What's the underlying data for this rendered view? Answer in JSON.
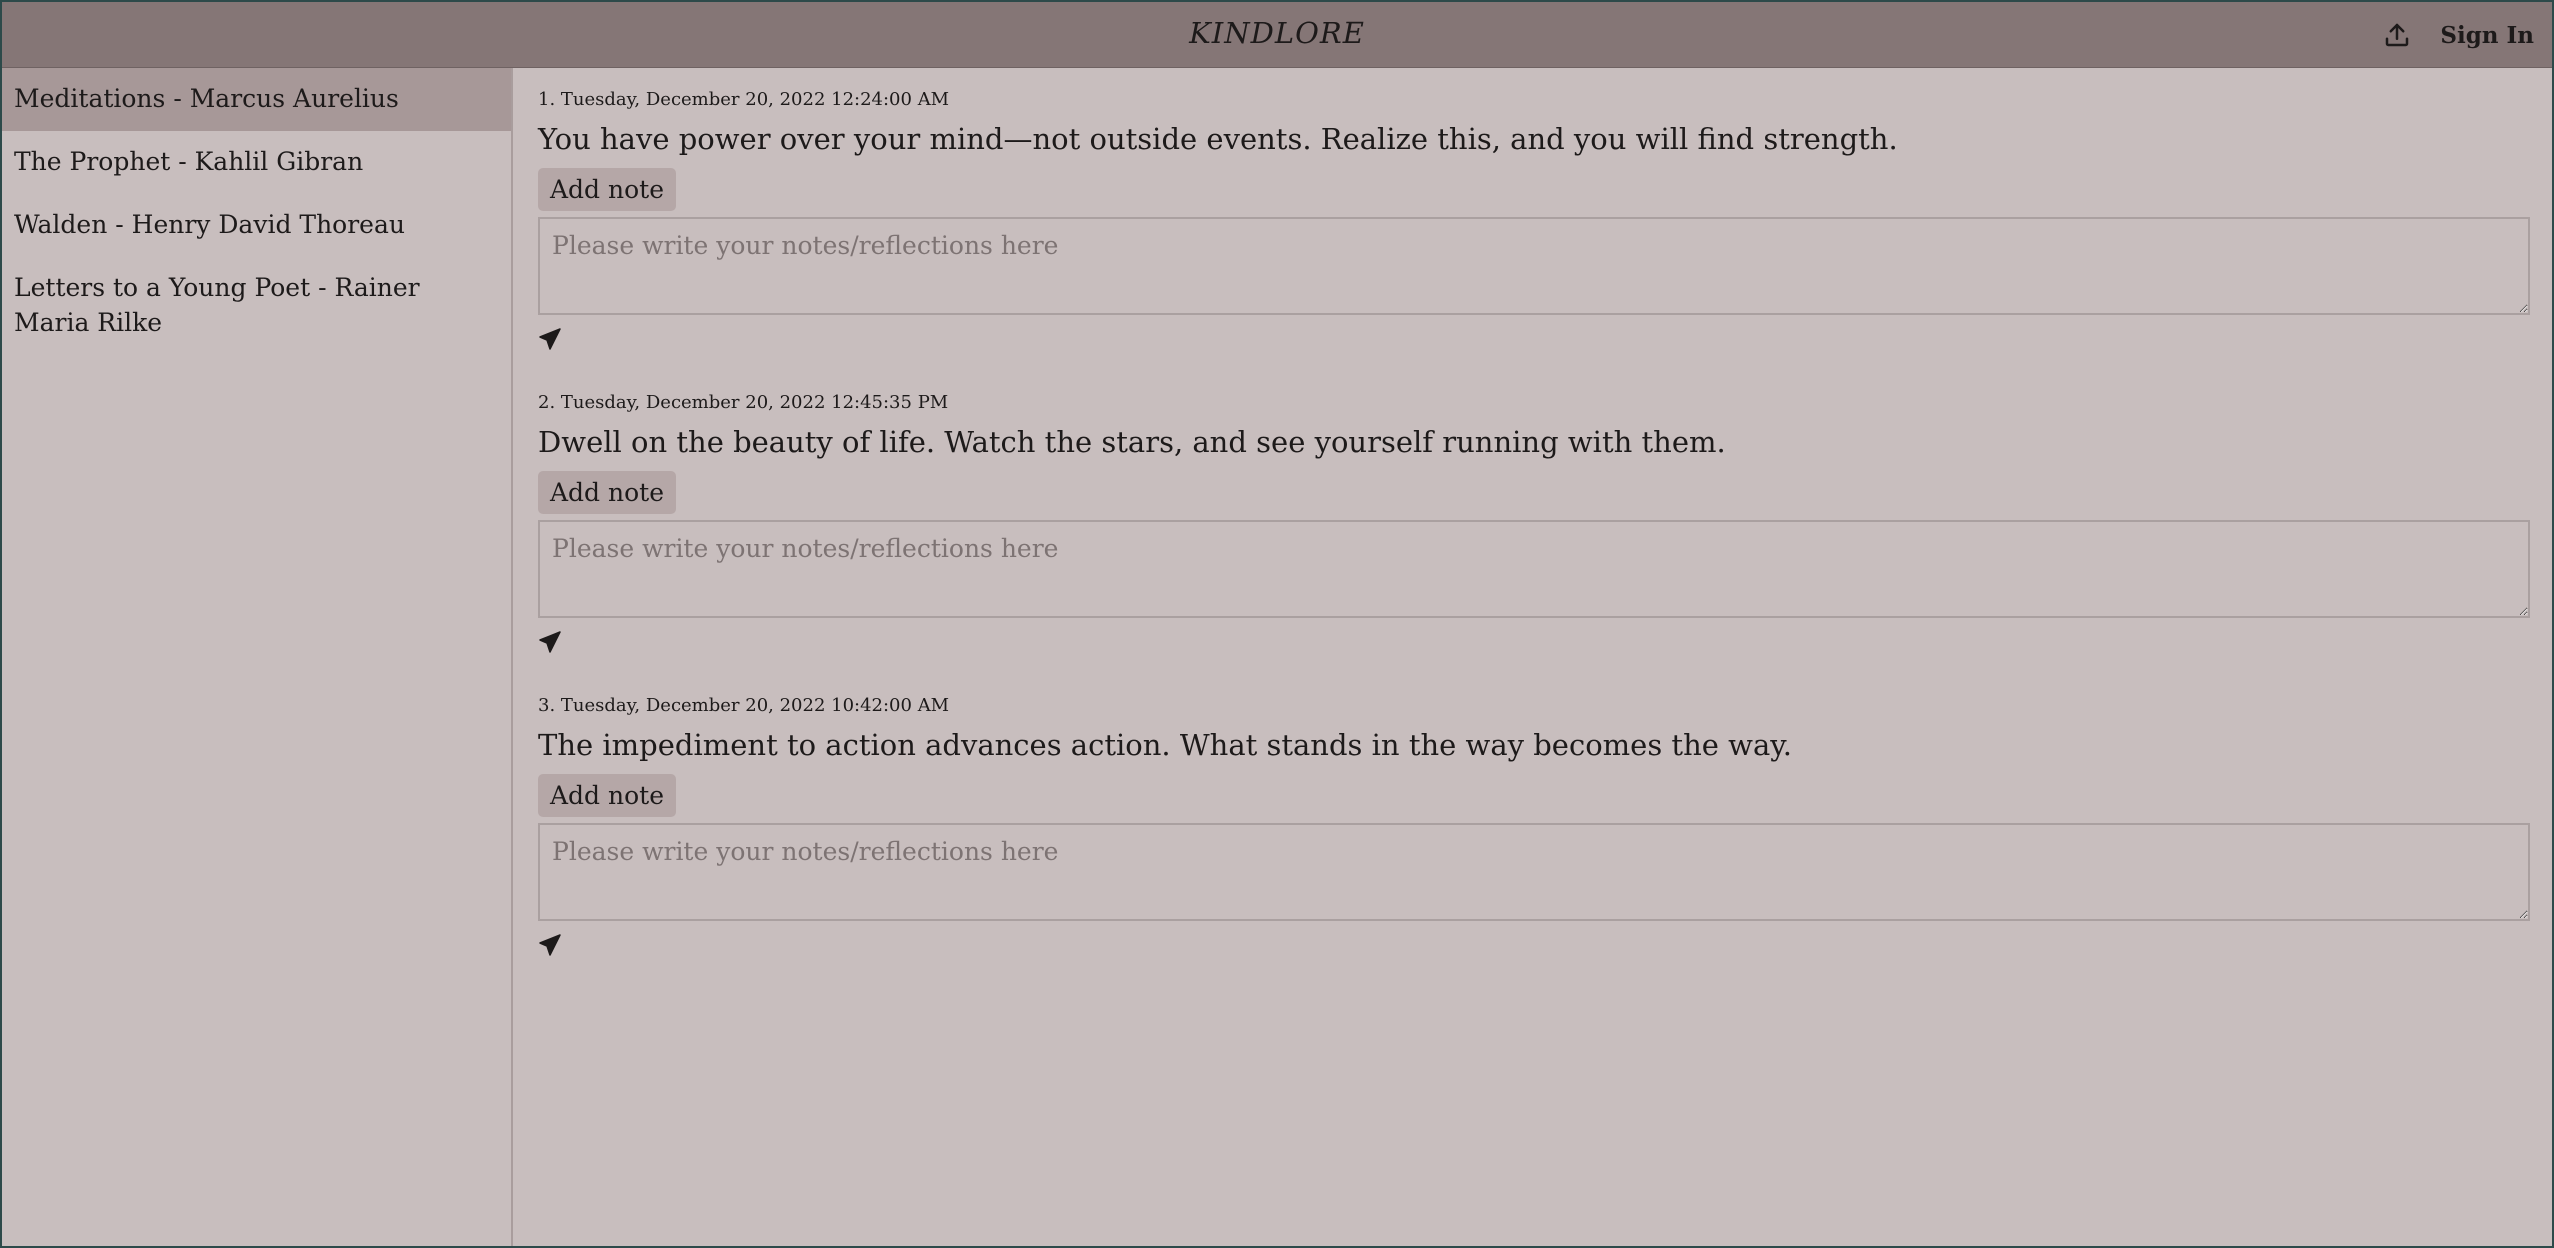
{
  "header": {
    "title": "KINDLORE",
    "upload_icon": "upload-icon",
    "sign_in": "Sign In"
  },
  "sidebar": {
    "items": [
      {
        "label": "Meditations - Marcus Aurelius",
        "active": true
      },
      {
        "label": "The Prophet - Kahlil Gibran",
        "active": false
      },
      {
        "label": "Walden - Henry David Thoreau",
        "active": false
      },
      {
        "label": "Letters to a Young Poet - Rainer Maria Rilke",
        "active": false
      }
    ]
  },
  "highlights": [
    {
      "date": "1. Tuesday, December 20, 2022 12:24:00 AM",
      "text": "You have power over your mind—not outside events. Realize this, and you will find strength.",
      "add_note_label": "Add note",
      "note_placeholder": "Please write your notes/reflections here",
      "note_value": ""
    },
    {
      "date": "2. Tuesday, December 20, 2022 12:45:35 PM",
      "text": "Dwell on the beauty of life. Watch the stars, and see yourself running with them.",
      "add_note_label": "Add note",
      "note_placeholder": "Please write your notes/reflections here",
      "note_value": ""
    },
    {
      "date": "3. Tuesday, December 20, 2022 10:42:00 AM",
      "text": "The impediment to action advances action. What stands in the way becomes the way.",
      "add_note_label": "Add note",
      "note_placeholder": "Please write your notes/reflections here",
      "note_value": ""
    }
  ],
  "icons": {
    "send": "send-icon"
  },
  "colors": {
    "header_bg": "#857676",
    "page_bg": "#c8bebe",
    "active_item_bg": "#a79898",
    "button_bg": "#b5a7a7"
  }
}
